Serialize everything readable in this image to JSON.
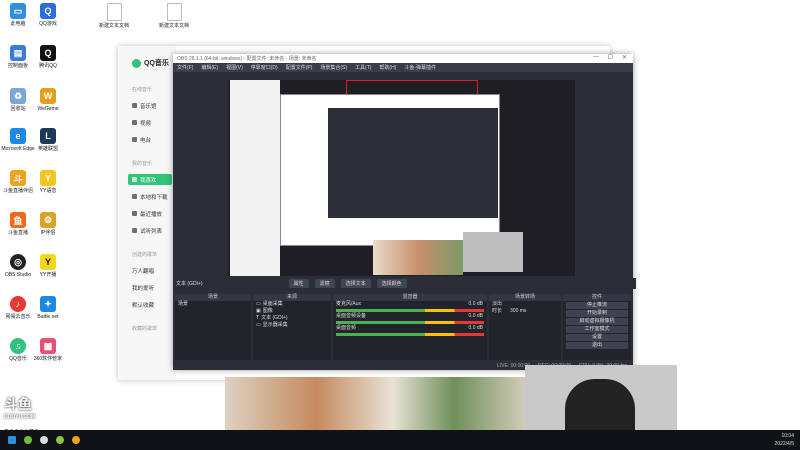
{
  "desktop": {
    "icons": [
      {
        "label": "此电脑",
        "color": "#2f8fdc"
      },
      {
        "label": "QQ游戏",
        "color": "#2a6fd6"
      },
      {
        "label": "新建文本文档",
        "color": "#ffffff"
      },
      {
        "label": "新建文本文档",
        "color": "#ffffff"
      },
      {
        "label": "控制面板",
        "color": "#3a7bd5"
      },
      {
        "label": "腾讯QQ",
        "color": "#111111"
      },
      {
        "label": "回收站",
        "color": "#7aa7d8"
      },
      {
        "label": "WeGame",
        "color": "#e0a21b"
      },
      {
        "label": "Microsoft Edge",
        "color": "#1e88e5"
      },
      {
        "label": "英雄联盟",
        "color": "#1b3a5b"
      },
      {
        "label": "斗鱼直播伴侣",
        "color": "#f0a21b"
      },
      {
        "label": "YY语音",
        "color": "#f7c51e"
      },
      {
        "label": "斗鱼直播",
        "color": "#f06a1b"
      },
      {
        "label": "IP伴侣",
        "color": "#d9a32b"
      },
      {
        "label": "OBS Studio",
        "color": "#222222"
      },
      {
        "label": "YY开播",
        "color": "#f7d51e"
      },
      {
        "label": "网易云音乐",
        "color": "#e53935"
      },
      {
        "label": "Battle.net",
        "color": "#1e88e5"
      },
      {
        "label": "QQ音乐",
        "color": "#31c27c"
      },
      {
        "label": "360软件管家",
        "color": "#e94e77"
      }
    ]
  },
  "qqmusic": {
    "logo": "QQ音乐",
    "sections": {
      "online": "在线音乐",
      "mine": "我的音乐",
      "created": "创建的歌单",
      "collected": "收藏的歌单"
    },
    "items": {
      "music_hall": "音乐馆",
      "video": "视频",
      "radio": "电台",
      "liked": "我喜欢",
      "local": "本地和下载",
      "recent": "最近播放",
      "trial": "试听列表",
      "playlist1": "万人翻唱",
      "playlist2": "我的爱听",
      "default": "默认收藏"
    }
  },
  "obs": {
    "title": "OBS 26.1.1 (64-bit, windows) - 配置文件: 未命名 - 场景: 未命名",
    "menu": [
      "文件(F)",
      "编辑(E)",
      "视图(V)",
      "停靠窗口(D)",
      "配置文件(P)",
      "场景集合(S)",
      "工具(T)",
      "帮助(H)",
      "斗鱼-弹幕插件"
    ],
    "context": {
      "source": "文本 (GDI+)",
      "props": "属性",
      "filters": "滤镜",
      "select_text": "选择文本",
      "select_color": "选择颜色"
    },
    "docks": {
      "scenes": "场景",
      "sources": "来源",
      "mixer": "混音器",
      "transitions": "场景转场",
      "controls": "控件"
    },
    "scene_item": "场景",
    "sources": [
      "桌面采集",
      "图像",
      "文本 (GDI+)",
      "显示器采集"
    ],
    "mixer": [
      {
        "name": "麦克风/Aux",
        "db": "0.0 dB"
      },
      {
        "name": "桌面音频设备",
        "db": "0.0 dB"
      },
      {
        "name": "桌面音频",
        "db": "0.0 dB"
      }
    ],
    "transitions": {
      "type": "淡出",
      "duration_label": "时长",
      "duration": "300 ms"
    },
    "controls": [
      "停止推流",
      "开始录制",
      "启动虚拟摄像机",
      "工作室模式",
      "设置",
      "退出"
    ],
    "status": {
      "live": "LIVE: 00:00:00",
      "rec": "REC: 00:00:00",
      "cpu": "CPU: 0.9%, 30.00 fps"
    }
  },
  "overlay": {
    "brand": "斗鱼",
    "brand_sub": "DOUYU.COM",
    "room_id": "5220173"
  },
  "tray": {
    "time": "10:04",
    "date": "2022/4/5"
  }
}
